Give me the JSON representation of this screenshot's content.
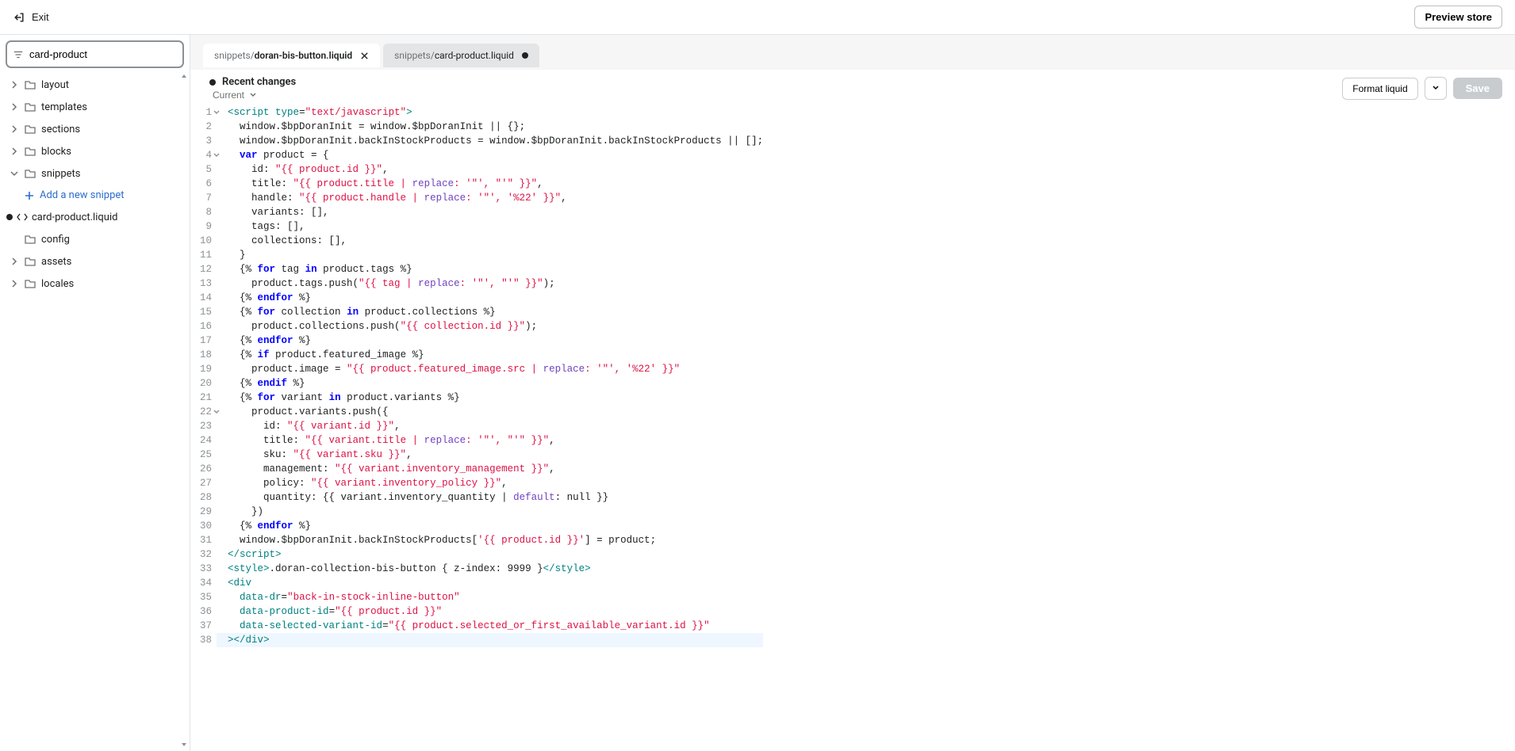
{
  "topbar": {
    "exit": "Exit",
    "preview": "Preview store"
  },
  "filter": {
    "value": "card-product"
  },
  "tree": {
    "folders": {
      "layout": "layout",
      "templates": "templates",
      "sections": "sections",
      "blocks": "blocks",
      "snippets": "snippets",
      "config": "config",
      "assets": "assets",
      "locales": "locales"
    },
    "add_snippet": "Add a new snippet",
    "file": "card-product.liquid"
  },
  "tabs": [
    {
      "path": "snippets/",
      "file": "doran-bis-button.liquid",
      "active": true,
      "dirty": false
    },
    {
      "path": "snippets/",
      "file": "card-product.liquid",
      "active": false,
      "dirty": true
    }
  ],
  "editor_header": {
    "title": "Recent changes",
    "current": "Current",
    "format": "Format liquid",
    "save": "Save"
  },
  "code": {
    "lines": [
      [
        [
          "t-tag",
          "<script"
        ],
        [
          "",
          " "
        ],
        [
          "t-attr",
          "type"
        ],
        [
          "",
          "="
        ],
        [
          "t-str",
          "\"text/javascript\""
        ],
        [
          "t-tag",
          ">"
        ]
      ],
      [
        [
          "",
          "  window.$bpDoranInit = window.$bpDoranInit || {};"
        ]
      ],
      [
        [
          "",
          "  window.$bpDoranInit.backInStockProducts = window.$bpDoranInit.backInStockProducts || [];"
        ]
      ],
      [
        [
          "",
          "  "
        ],
        [
          "t-kw",
          "var"
        ],
        [
          "",
          " product = {"
        ]
      ],
      [
        [
          "",
          "    id: "
        ],
        [
          "t-str",
          "\"{{ product.id }}\""
        ],
        [
          "",
          ","
        ]
      ],
      [
        [
          "",
          "    title: "
        ],
        [
          "t-str",
          "\"{{ product.title | "
        ],
        [
          "t-op",
          "replace"
        ],
        [
          "t-str",
          ": '\"', \"'\" }}\""
        ],
        [
          "",
          ","
        ]
      ],
      [
        [
          "",
          "    handle: "
        ],
        [
          "t-str",
          "\"{{ product.handle | "
        ],
        [
          "t-op",
          "replace"
        ],
        [
          "t-str",
          ": '\"', '%22' }}\""
        ],
        [
          "",
          ","
        ]
      ],
      [
        [
          "",
          "    variants: [],"
        ]
      ],
      [
        [
          "",
          "    tags: [],"
        ]
      ],
      [
        [
          "",
          "    collections: [],"
        ]
      ],
      [
        [
          "",
          "  }"
        ]
      ],
      [
        [
          "",
          "  {% "
        ],
        [
          "t-kw",
          "for"
        ],
        [
          "",
          " tag "
        ],
        [
          "t-kw",
          "in"
        ],
        [
          "",
          " product.tags %}"
        ]
      ],
      [
        [
          "",
          "    product.tags.push("
        ],
        [
          "t-str",
          "\"{{ tag | "
        ],
        [
          "t-op",
          "replace"
        ],
        [
          "t-str",
          ": '\"', \"'\" }}\""
        ],
        [
          "",
          ");"
        ]
      ],
      [
        [
          "",
          "  {% "
        ],
        [
          "t-kw",
          "endfor"
        ],
        [
          "",
          " %}"
        ]
      ],
      [
        [
          "",
          "  {% "
        ],
        [
          "t-kw",
          "for"
        ],
        [
          "",
          " collection "
        ],
        [
          "t-kw",
          "in"
        ],
        [
          "",
          " product.collections %}"
        ]
      ],
      [
        [
          "",
          "    product.collections.push("
        ],
        [
          "t-str",
          "\"{{ collection.id }}\""
        ],
        [
          "",
          ");"
        ]
      ],
      [
        [
          "",
          "  {% "
        ],
        [
          "t-kw",
          "endfor"
        ],
        [
          "",
          " %}"
        ]
      ],
      [
        [
          "",
          "  {% "
        ],
        [
          "t-kw",
          "if"
        ],
        [
          "",
          " product.featured_image %}"
        ]
      ],
      [
        [
          "",
          "    product.image = "
        ],
        [
          "t-str",
          "\"{{ product.featured_image.src | "
        ],
        [
          "t-op",
          "replace"
        ],
        [
          "t-str",
          ": '\"', '%22' }}\""
        ]
      ],
      [
        [
          "",
          "  {% "
        ],
        [
          "t-kw",
          "endif"
        ],
        [
          "",
          " %}"
        ]
      ],
      [
        [
          "",
          "  {% "
        ],
        [
          "t-kw",
          "for"
        ],
        [
          "",
          " variant "
        ],
        [
          "t-kw",
          "in"
        ],
        [
          "",
          " product.variants %}"
        ]
      ],
      [
        [
          "",
          "    product.variants.push({"
        ]
      ],
      [
        [
          "",
          "      id: "
        ],
        [
          "t-str",
          "\"{{ variant.id }}\""
        ],
        [
          "",
          ","
        ]
      ],
      [
        [
          "",
          "      title: "
        ],
        [
          "t-str",
          "\"{{ variant.title | "
        ],
        [
          "t-op",
          "replace"
        ],
        [
          "t-str",
          ": '\"', \"'\" }}\""
        ],
        [
          "",
          ","
        ]
      ],
      [
        [
          "",
          "      sku: "
        ],
        [
          "t-str",
          "\"{{ variant.sku }}\""
        ],
        [
          "",
          ","
        ]
      ],
      [
        [
          "",
          "      management: "
        ],
        [
          "t-str",
          "\"{{ variant.inventory_management }}\""
        ],
        [
          "",
          ","
        ]
      ],
      [
        [
          "",
          "      policy: "
        ],
        [
          "t-str",
          "\"{{ variant.inventory_policy }}\""
        ],
        [
          "",
          ","
        ]
      ],
      [
        [
          "",
          "      quantity: {{ variant.inventory_quantity | "
        ],
        [
          "t-op",
          "default"
        ],
        [
          "",
          ": null }}"
        ]
      ],
      [
        [
          "",
          "    })"
        ]
      ],
      [
        [
          "",
          "  {% "
        ],
        [
          "t-kw",
          "endfor"
        ],
        [
          "",
          " %}"
        ]
      ],
      [
        [
          "",
          "  window.$bpDoranInit.backInStockProducts["
        ],
        [
          "t-id",
          "'{{ product.id }}'"
        ],
        [
          "",
          "] = product;"
        ]
      ],
      [
        [
          "t-tag",
          "</scr"
        ],
        [
          "t-tag",
          "ipt>"
        ]
      ],
      [
        [
          "t-tag",
          "<style>"
        ],
        [
          "",
          ".doran-collection-bis-button { z-index: 9999 }"
        ],
        [
          "t-tag",
          "</style>"
        ]
      ],
      [
        [
          "t-tag",
          "<div"
        ]
      ],
      [
        [
          "",
          "  "
        ],
        [
          "t-attr",
          "data-dr"
        ],
        [
          "",
          "="
        ],
        [
          "t-str",
          "\"back-in-stock-inline-button\""
        ]
      ],
      [
        [
          "",
          "  "
        ],
        [
          "t-attr",
          "data-product-id"
        ],
        [
          "",
          "="
        ],
        [
          "t-str",
          "\"{{ product.id }}\""
        ]
      ],
      [
        [
          "",
          "  "
        ],
        [
          "t-attr",
          "data-selected-variant-id"
        ],
        [
          "",
          "="
        ],
        [
          "t-str",
          "\"{{ product.selected_or_first_available_variant.id }}\""
        ]
      ],
      [
        [
          "t-tag",
          ">"
        ],
        [
          "t-tag",
          "</"
        ],
        [
          "t-attr",
          "div"
        ],
        [
          "t-tag",
          ">"
        ]
      ]
    ],
    "foldable": [
      1,
      4,
      22
    ],
    "highlighted": 38
  }
}
